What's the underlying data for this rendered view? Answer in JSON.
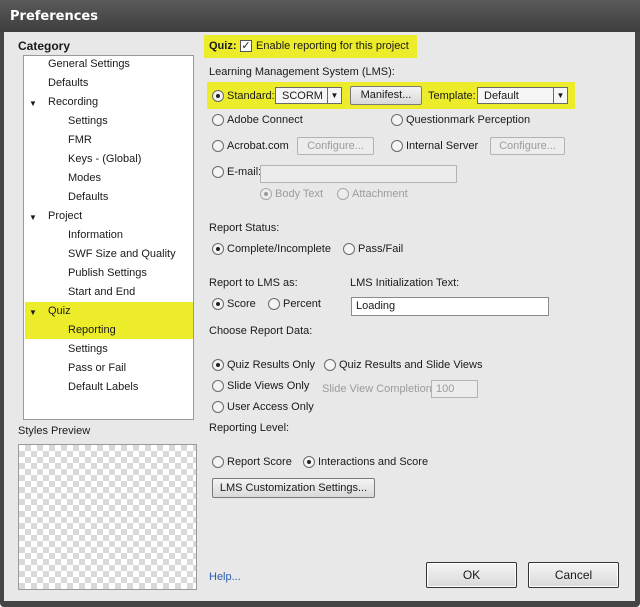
{
  "window": {
    "title": "Preferences"
  },
  "category": {
    "title": "Category",
    "items": [
      {
        "label": "General Settings"
      },
      {
        "label": "Defaults"
      },
      {
        "label": "Recording"
      },
      {
        "label": "Settings"
      },
      {
        "label": "FMR"
      },
      {
        "label": "Keys - (Global)"
      },
      {
        "label": "Modes"
      },
      {
        "label": "Defaults"
      },
      {
        "label": "Project"
      },
      {
        "label": "Information"
      },
      {
        "label": "SWF Size and Quality"
      },
      {
        "label": "Publish Settings"
      },
      {
        "label": "Start and End"
      },
      {
        "label": "Quiz"
      },
      {
        "label": "Reporting"
      },
      {
        "label": "Settings"
      },
      {
        "label": "Pass or Fail"
      },
      {
        "label": "Default Labels"
      }
    ],
    "selected": "Reporting"
  },
  "styles_preview": {
    "label": "Styles Preview"
  },
  "quiz": {
    "prefix": "Quiz:",
    "enable_label": "Enable reporting for this project",
    "enabled": true
  },
  "lms": {
    "label": "Learning Management System (LMS):",
    "standard_label": "Standard:",
    "standard_value": "SCORM",
    "manifest_button": "Manifest...",
    "template_label": "Template:",
    "template_value": "Default",
    "adobe_connect": "Adobe Connect",
    "questionmark": "Questionmark Perception",
    "acrobat": "Acrobat.com",
    "configure_label": "Configure...",
    "internal_server": "Internal Server",
    "email": "E-mail:",
    "email_value": "",
    "body_text": "Body Text",
    "attachment": "Attachment"
  },
  "report_status": {
    "label": "Report Status:",
    "complete": "Complete/Incomplete",
    "pass_fail": "Pass/Fail"
  },
  "report_to_lms": {
    "label": "Report to LMS as:",
    "score": "Score",
    "percent": "Percent"
  },
  "lms_init": {
    "label": "LMS Initialization Text:",
    "value": "Loading"
  },
  "report_data": {
    "label": "Choose Report Data:",
    "quiz_results_only": "Quiz Results Only",
    "quiz_results_slide": "Quiz Results and Slide Views",
    "slide_views_only": "Slide Views Only",
    "slide_view_completion": "Slide View Completion",
    "slide_view_value": "100",
    "user_access_only": "User Access Only"
  },
  "reporting_level": {
    "label": "Reporting Level:",
    "report_score": "Report Score",
    "interactions": "Interactions and Score"
  },
  "lms_custom_button": "LMS Customization Settings...",
  "help_link": "Help...",
  "ok_button": "OK",
  "cancel_button": "Cancel",
  "colors": {
    "highlight": "#ecec2a",
    "titlebar": "#454545",
    "panel": "#e8e8e8",
    "link": "#2a5db0"
  }
}
